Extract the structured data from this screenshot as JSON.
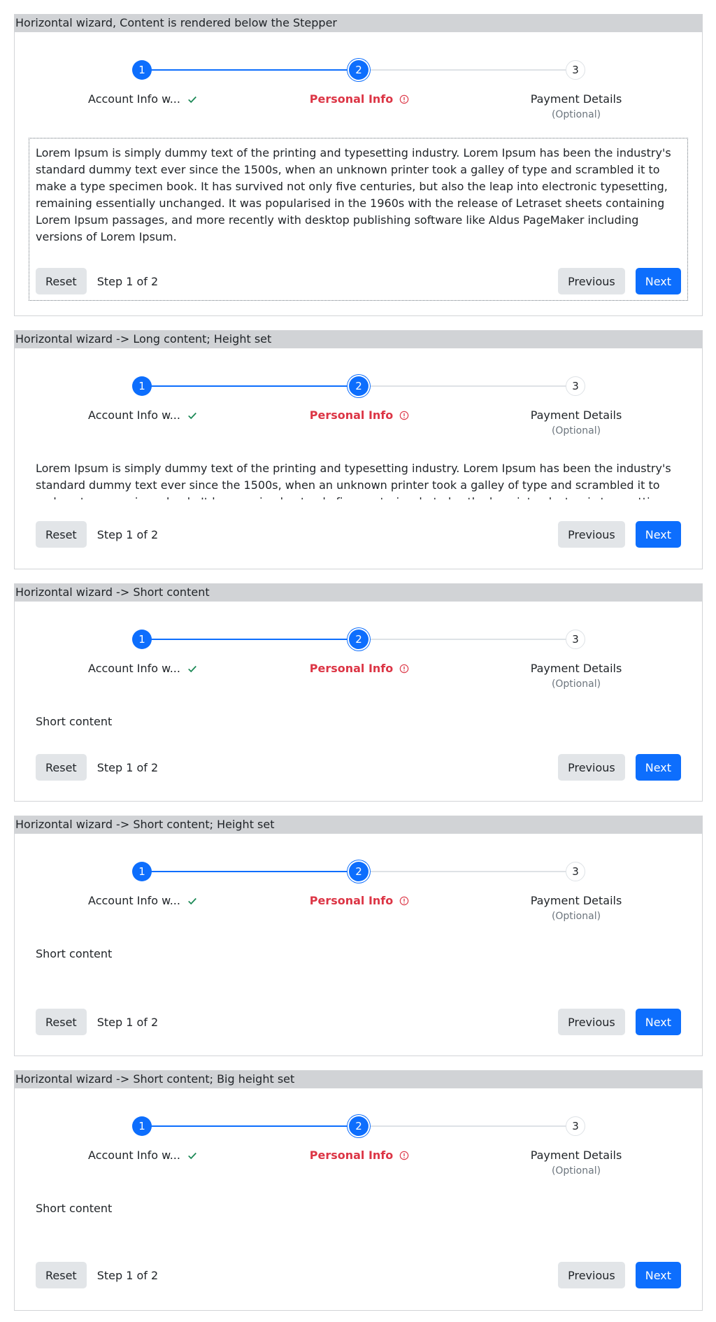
{
  "steps": {
    "step1": {
      "number": "1",
      "label": "Account Info w..."
    },
    "step2": {
      "number": "2",
      "label": "Personal Info"
    },
    "step3": {
      "number": "3",
      "label": "Payment Details",
      "optional": "(Optional)"
    }
  },
  "footer": {
    "reset_label": "Reset",
    "step_count": "Step 1 of 2",
    "previous_label": "Previous",
    "next_label": "Next"
  },
  "long_text": "Lorem Ipsum is simply dummy text of the printing and typesetting industry. Lorem Ipsum has been the industry's standard dummy text ever since the 1500s, when an unknown printer took a galley of type and scrambled it to make a type specimen book. It has survived not only five centuries, but also the leap into electronic typesetting, remaining essentially unchanged. It was popularised in the 1960s with the release of Letraset sheets containing Lorem Ipsum passages, and more recently with desktop publishing software like Aldus PageMaker including versions of Lorem Ipsum.",
  "short_text": "Short content",
  "wizards": [
    {
      "title": "Horizontal wizard, Content is rendered below the Stepper"
    },
    {
      "title": "Horizontal wizard -> Long content; Height set"
    },
    {
      "title": "Horizontal wizard -> Short content"
    },
    {
      "title": "Horizontal wizard -> Short content; Height set"
    },
    {
      "title": "Horizontal wizard -> Short content; Big height set"
    }
  ],
  "colors": {
    "primary": "#0d6efd",
    "danger": "#dc3545",
    "success": "#198754",
    "header_bg": "#d1d3d6"
  }
}
